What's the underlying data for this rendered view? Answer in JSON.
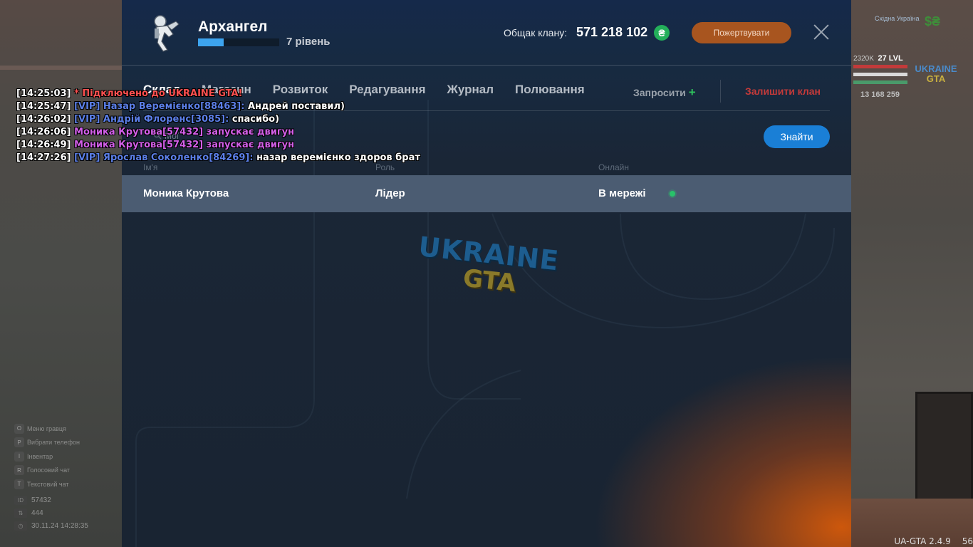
{
  "clan": {
    "name": "Архангел",
    "level_text": "7 рівень",
    "level_progress": 0.32,
    "bank_label": "Общак клану:",
    "bank_value": "571 218 102",
    "currency_symbol": "₴",
    "donate_label": "Пожертвувати"
  },
  "tabs": [
    {
      "label": "Склад"
    },
    {
      "label": "Магазин"
    },
    {
      "label": "Розвиток"
    },
    {
      "label": "Редагування"
    },
    {
      "label": "Журнал"
    },
    {
      "label": "Полювання"
    }
  ],
  "actions": {
    "invite_label": "Запросити",
    "leave_label": "Залишити клан"
  },
  "search": {
    "placeholder": "Мої",
    "button_label": "Знайти"
  },
  "table": {
    "headers": [
      "Ім'я",
      "Роль",
      "Онлайн"
    ],
    "rows": [
      {
        "name": "Моника Крутова",
        "role": "Лідер",
        "online": "В мережі"
      }
    ]
  },
  "logo": {
    "line1": "UKRAINE",
    "line2": "GTA"
  },
  "chat": [
    {
      "time": "[14:25:03]",
      "prefix": "* Підключено до UKRAINE GTA!",
      "prefix_style": "sys",
      "message": ""
    },
    {
      "time": "[14:25:47]",
      "prefix": "[VIP] Назар Веремієнко[88463]:",
      "prefix_style": "vip",
      "message": "Андрей поставил)"
    },
    {
      "time": "[14:26:02]",
      "prefix": "[VIP] Андрій Флоренс[3085]:",
      "prefix_style": "vip",
      "message": "спасибо)"
    },
    {
      "time": "[14:26:06]",
      "prefix": "Моника Крутова[57432] запускає двигун",
      "prefix_style": "pink",
      "message": ""
    },
    {
      "time": "[14:26:49]",
      "prefix": "Моника Крутова[57432] запускає двигун",
      "prefix_style": "pink",
      "message": ""
    },
    {
      "time": "[14:27:26]",
      "prefix": "[VIP] Ярослав Соколенко[84269]:",
      "prefix_style": "vip",
      "message": "назар веремієнко здоров брат"
    }
  ],
  "hud": {
    "region": "Східна Україна",
    "level_text": "27 LVL",
    "exp": "2320K",
    "balance": "13 168 259",
    "id_label": "ID",
    "id_value": "57432",
    "ping_value": "444",
    "datetime": "30.11.24 14:28:35",
    "menu_items": [
      {
        "key": "O",
        "label": "Меню гравця"
      },
      {
        "key": "P",
        "label": "Вибрати телефон"
      },
      {
        "key": "I",
        "label": "Інвентар"
      },
      {
        "key": "R",
        "label": "Голосовий чат"
      },
      {
        "key": "T",
        "label": "Текстовий чат"
      }
    ]
  },
  "version": {
    "name": "UA-GTA 2.4.9",
    "fps": "56"
  },
  "colors": {
    "accent_blue": "#1a7fd6",
    "donate_orange": "#a8551f",
    "leave_red": "#c43a3a",
    "online_green": "#28c26a",
    "vip_blue": "#5b7fe8",
    "system_red": "#ff5050",
    "action_pink": "#d25fe8"
  }
}
